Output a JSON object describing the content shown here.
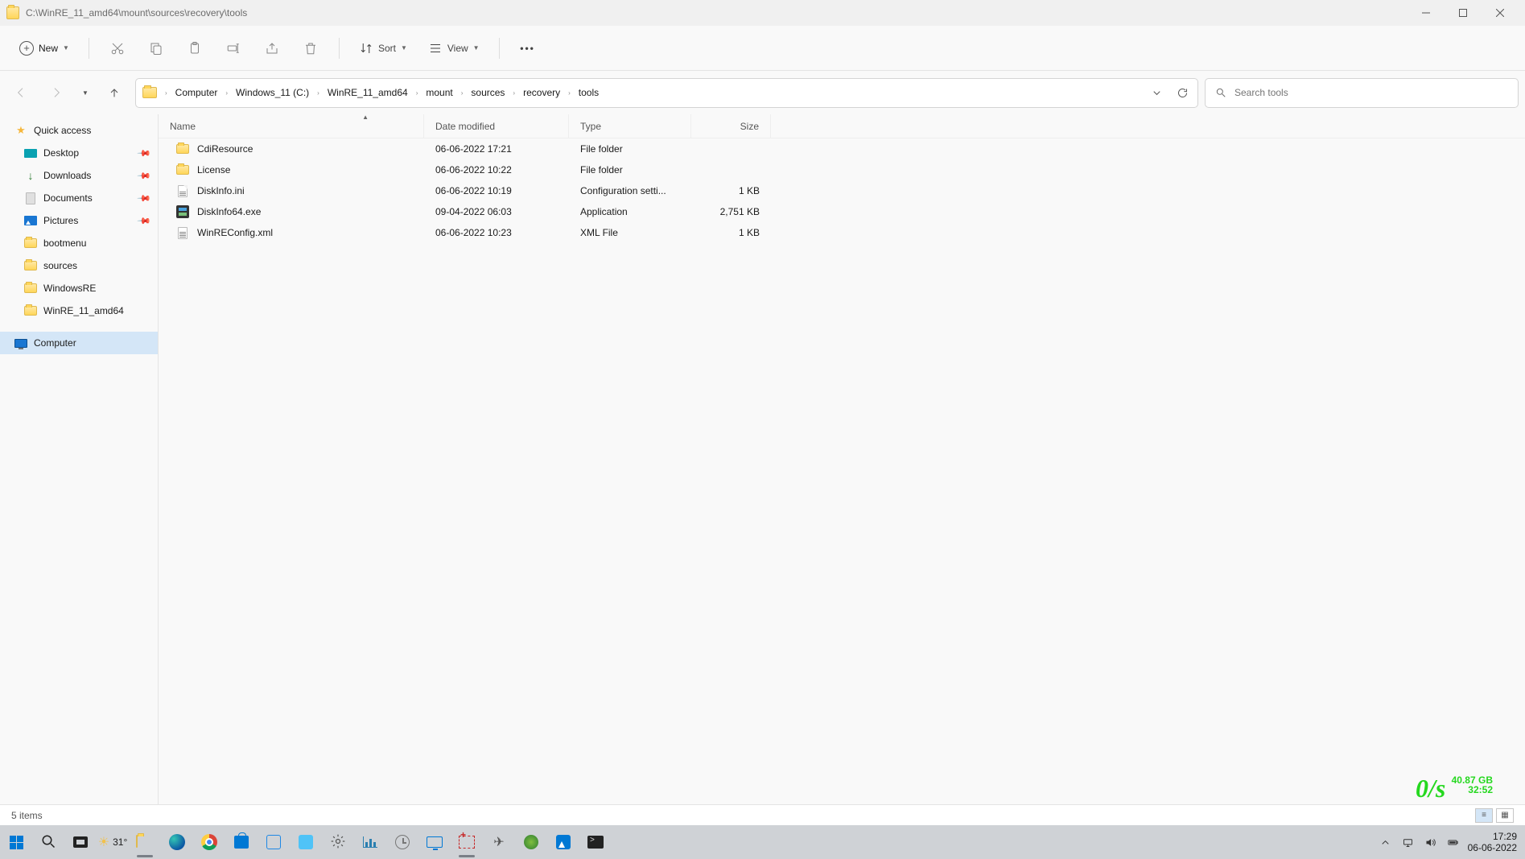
{
  "window": {
    "title": "C:\\WinRE_11_amd64\\mount\\sources\\recovery\\tools"
  },
  "toolbar": {
    "new_label": "New",
    "sort_label": "Sort",
    "view_label": "View"
  },
  "breadcrumbs": {
    "b0": "Computer",
    "b1": "Windows_11 (C:)",
    "b2": "WinRE_11_amd64",
    "b3": "mount",
    "b4": "sources",
    "b5": "recovery",
    "b6": "tools"
  },
  "search": {
    "placeholder": "Search tools"
  },
  "sidebar": {
    "quick_access": "Quick access",
    "desktop": "Desktop",
    "downloads": "Downloads",
    "documents": "Documents",
    "pictures": "Pictures",
    "bootmenu": "bootmenu",
    "sources": "sources",
    "windowsre": "WindowsRE",
    "winre11": "WinRE_11_amd64",
    "computer": "Computer"
  },
  "columns": {
    "name": "Name",
    "date": "Date modified",
    "type": "Type",
    "size": "Size"
  },
  "files": {
    "r0": {
      "name": "CdiResource",
      "date": "06-06-2022 17:21",
      "type": "File folder",
      "size": ""
    },
    "r1": {
      "name": "License",
      "date": "06-06-2022 10:22",
      "type": "File folder",
      "size": ""
    },
    "r2": {
      "name": "DiskInfo.ini",
      "date": "06-06-2022 10:19",
      "type": "Configuration setti...",
      "size": "1 KB"
    },
    "r3": {
      "name": "DiskInfo64.exe",
      "date": "09-04-2022 06:03",
      "type": "Application",
      "size": "2,751 KB"
    },
    "r4": {
      "name": "WinREConfig.xml",
      "date": "06-06-2022 10:23",
      "type": "XML File",
      "size": "1 KB"
    }
  },
  "status": {
    "items": "5 items"
  },
  "netmon": {
    "rate": "0/s",
    "space": "40.87 GB",
    "time": "32:52"
  },
  "taskbar": {
    "temp": "31°",
    "time": "17:29",
    "date": "06-06-2022"
  }
}
